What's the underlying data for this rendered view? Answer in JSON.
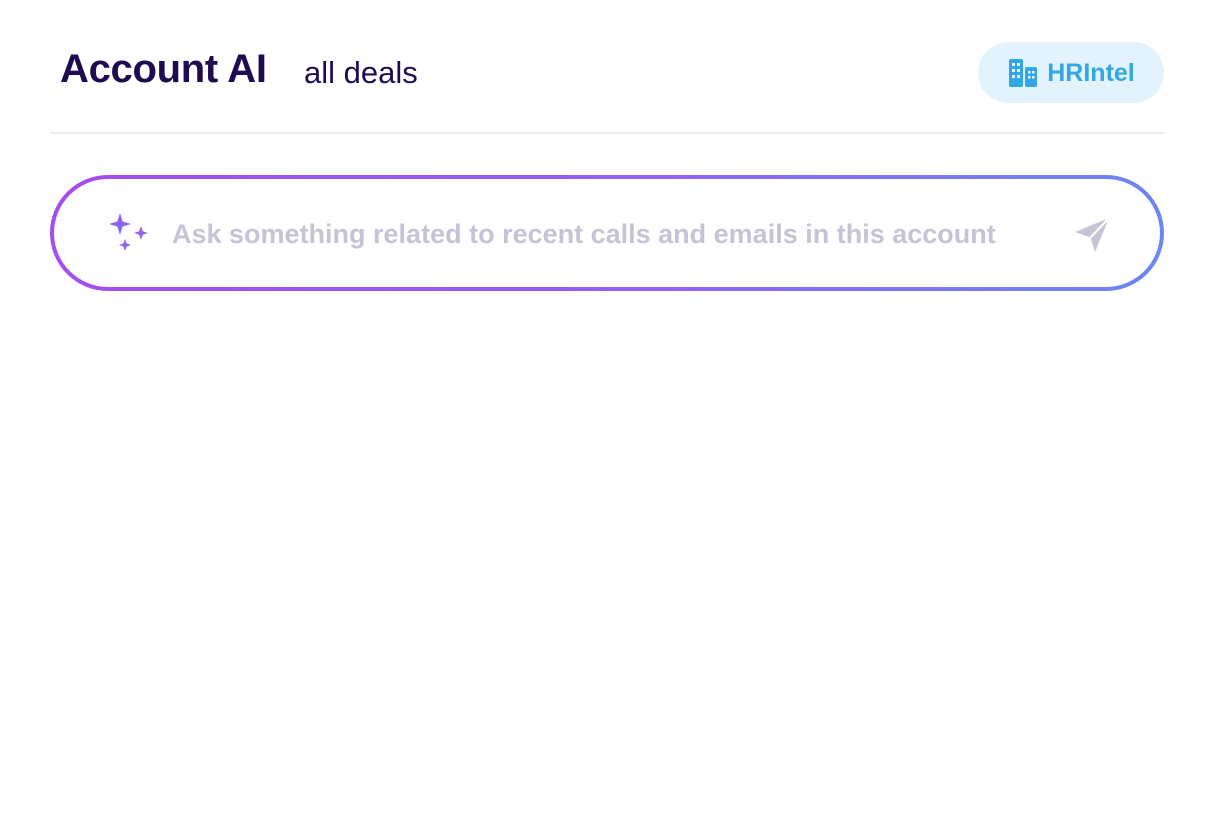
{
  "header": {
    "title": "Account AI",
    "subtitle": "all deals",
    "account_chip": {
      "label": "HRIntel",
      "icon": "building-icon",
      "color": "#33a6e6",
      "background": "#e3f3fd"
    }
  },
  "ask": {
    "placeholder": "Ask something related to recent calls and emails in this account",
    "leading_icon": "sparkle-icon",
    "send_icon": "send-icon",
    "gradient": [
      "#a64cf0",
      "#6c86f2"
    ]
  },
  "colors": {
    "title": "#1e0b52",
    "divider": "#ececf0",
    "placeholder": "#c6c3d4"
  }
}
